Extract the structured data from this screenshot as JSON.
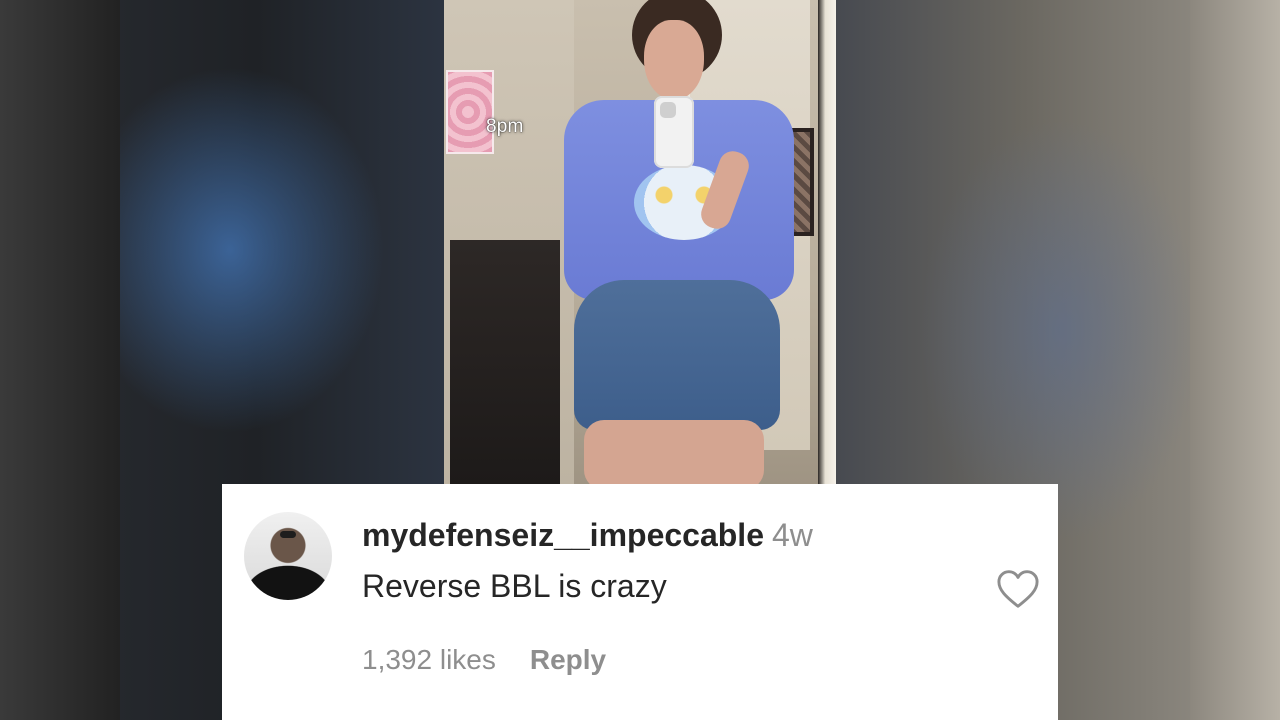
{
  "video": {
    "overlay_text": "8pm"
  },
  "comment": {
    "username": "mydefenseiz__impeccable",
    "age": "4w",
    "text": "Reverse BBL is crazy",
    "likes": "1,392 likes",
    "reply_label": "Reply",
    "like_icon": "heart-outline-icon"
  },
  "colors": {
    "username": "#262626",
    "meta": "#8e8e8e",
    "card_background": "#ffffff"
  }
}
